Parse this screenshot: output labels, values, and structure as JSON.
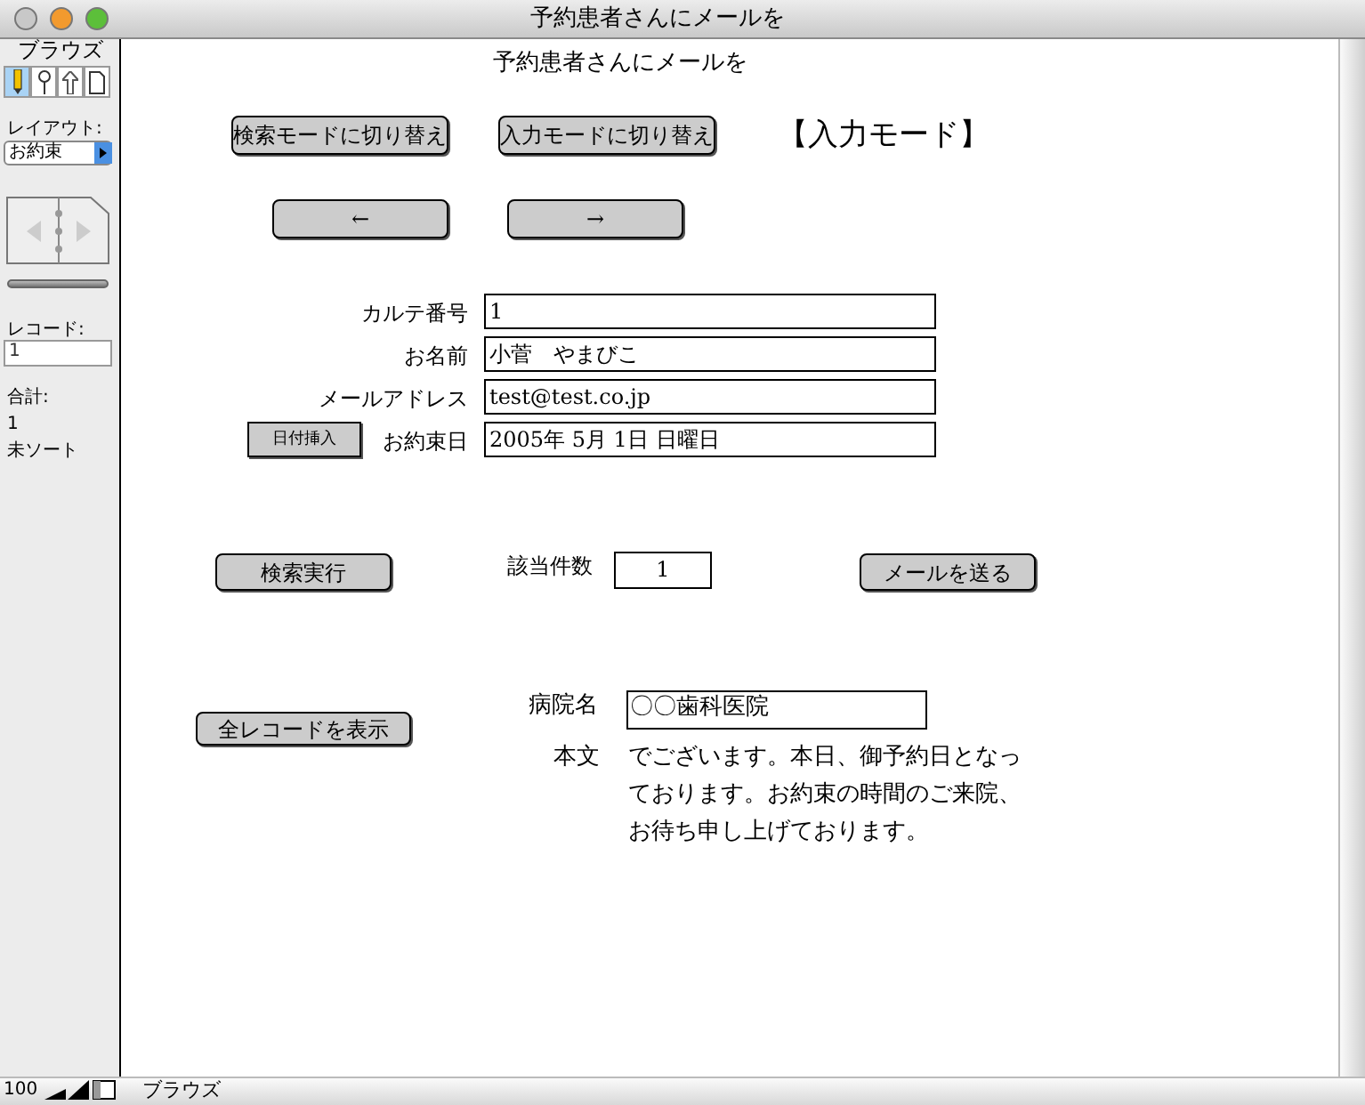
{
  "window": {
    "title": "予約患者さんにメールを"
  },
  "sidebar": {
    "mode_label": "ブラウズ",
    "tools": [
      {
        "kind": "pencil",
        "selected": true
      },
      {
        "kind": "magnifier",
        "selected": false
      },
      {
        "kind": "arrow",
        "selected": false
      },
      {
        "kind": "page",
        "selected": false
      }
    ],
    "layout_label": "レイアウト:",
    "layout_value": "お約束",
    "record_label": "レコード:",
    "record_value": "1",
    "total_label": "合計:",
    "total_value": "1",
    "sort_status": "未ソート"
  },
  "form": {
    "title": "予約患者さんにメールを",
    "search_mode_button": "検索モードに切り替え",
    "input_mode_button": "入力モードに切り替え",
    "mode_indicator": "【入力モード】",
    "prev_button": "←",
    "next_button": "→",
    "fields": [
      {
        "label": "カルテ番号",
        "value": "1"
      },
      {
        "label": "お名前",
        "value": "小菅　やまびこ"
      },
      {
        "label": "メールアドレス",
        "value": "test@test.co.jp"
      },
      {
        "label": "お約束日",
        "value": "2005年 5月 1日 日曜日"
      }
    ],
    "date_button": "日付挿入",
    "search_button": "検索実行",
    "count_label": "該当件数",
    "count_value": "1",
    "send_button": "メールを送る",
    "show_all_button": "全レコードを表示",
    "hospital_label": "病院名",
    "hospital_value": "〇〇歯科医院",
    "body_label": "本文",
    "body_lines": [
      "でございます。本日、御予約日となっ",
      "ております。お約束の時間のご来院、",
      "お待ち申し上げております。"
    ]
  },
  "status_bar": {
    "zoom": "100",
    "mode": "ブラウズ"
  }
}
